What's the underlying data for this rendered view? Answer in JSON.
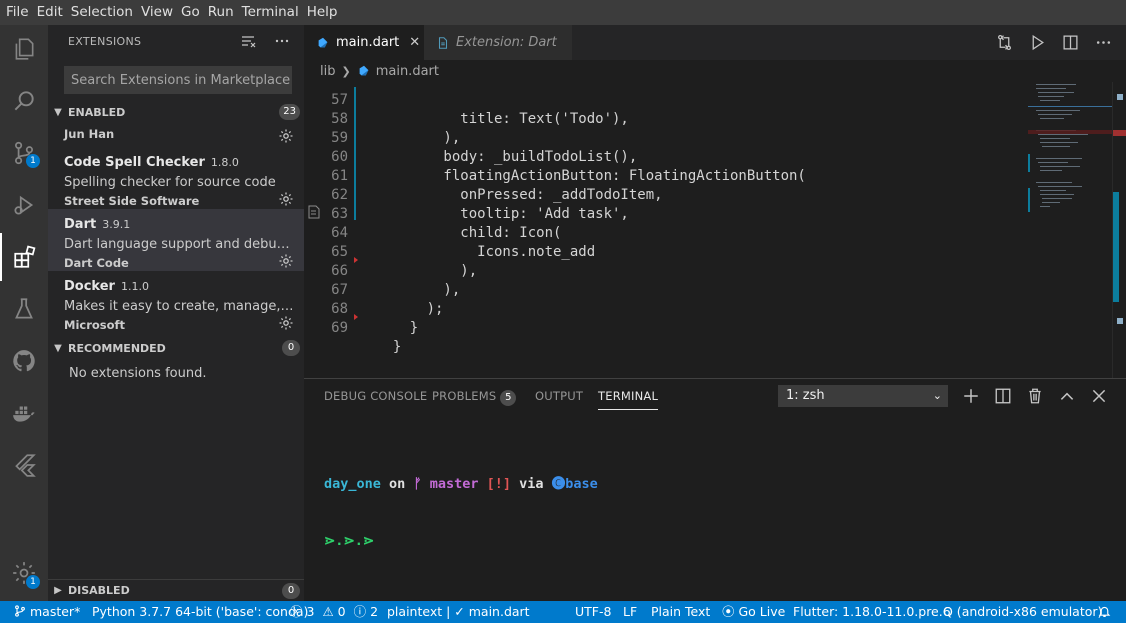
{
  "menu": [
    "File",
    "Edit",
    "Selection",
    "View",
    "Go",
    "Run",
    "Terminal",
    "Help"
  ],
  "activity_badges": {
    "source_control": "1",
    "settings": "1"
  },
  "sidebar": {
    "title": "EXTENSIONS",
    "search_placeholder": "Search Extensions in Marketplace",
    "enabled": {
      "label": "ENABLED",
      "count": "23"
    },
    "partial_publisher": "Jun Han",
    "extensions": [
      {
        "name": "Code Spell Checker",
        "version": "1.8.0",
        "description": "Spelling checker for source code",
        "publisher": "Street Side Software"
      },
      {
        "name": "Dart",
        "version": "3.9.1",
        "description": "Dart language support and debugger for Visual Studio Code.",
        "publisher": "Dart Code"
      },
      {
        "name": "Docker",
        "version": "1.1.0",
        "description": "Makes it easy to create, manage, and debug containerized applications.",
        "publisher": "Microsoft"
      }
    ],
    "recommended": {
      "label": "RECOMMENDED",
      "count": "0",
      "empty": "No extensions found."
    },
    "disabled": {
      "label": "DISABLED",
      "count": "0"
    }
  },
  "tabs": [
    {
      "label": "main.dart",
      "close": "✕"
    },
    {
      "label": "Extension: Dart"
    }
  ],
  "breadcrumb": {
    "folder": "lib",
    "file": "main.dart"
  },
  "code": [
    {
      "n": "57",
      "t": "          title: Text('Todo'),"
    },
    {
      "n": "58",
      "t": "        ),"
    },
    {
      "n": "59",
      "t": "        body: _buildTodoList(),"
    },
    {
      "n": "60",
      "t": "        floatingActionButton: FloatingActionButton("
    },
    {
      "n": "61",
      "t": "          onPressed: _addTodoItem,"
    },
    {
      "n": "62",
      "t": "          tooltip: 'Add task',"
    },
    {
      "n": "63",
      "t": "          child: Icon("
    },
    {
      "n": "64",
      "t": "            Icons.note_add"
    },
    {
      "n": "65",
      "t": "          ),"
    },
    {
      "n": "66",
      "t": "        ),"
    },
    {
      "n": "67",
      "t": "      );"
    },
    {
      "n": "68",
      "t": "    }"
    },
    {
      "n": "69",
      "t": "  }"
    }
  ],
  "panel": {
    "tabs": [
      "DEBUG CONSOLE",
      "PROBLEMS",
      "OUTPUT",
      "TERMINAL"
    ],
    "problems_count": "5",
    "terminal_select": "1: zsh",
    "prompt": {
      "dir": "day_one",
      "on": "on",
      "branch_icon": "ᚠ",
      "branch": "master",
      "status": "[!]",
      "via": "via",
      "env_icon": "🅒",
      "env": "base",
      "arrows": "⋗.⋗.⋗"
    }
  },
  "status": {
    "branch": "master*",
    "python": "Python 3.7.7 64-bit ('base': conda)",
    "errors": "3",
    "warnings": "0",
    "info": "2",
    "lang_mode": "plaintext | ✓ main.dart",
    "encoding": "UTF-8",
    "eol": "LF",
    "language": "Plain Text",
    "golive": "Go Live",
    "flutter": "Flutter: 1.18.0-11.0.pre.6",
    "device": "Q (android-x86 emulator)"
  },
  "colors": {
    "accent": "#007acc",
    "string": "#ce9178",
    "func": "#dcdcaa",
    "keyword": "#569cd6",
    "term_cyan": "#3ab7d6",
    "term_magenta": "#c36bd6",
    "term_red": "#e05555",
    "term_green": "#2ed16b"
  }
}
